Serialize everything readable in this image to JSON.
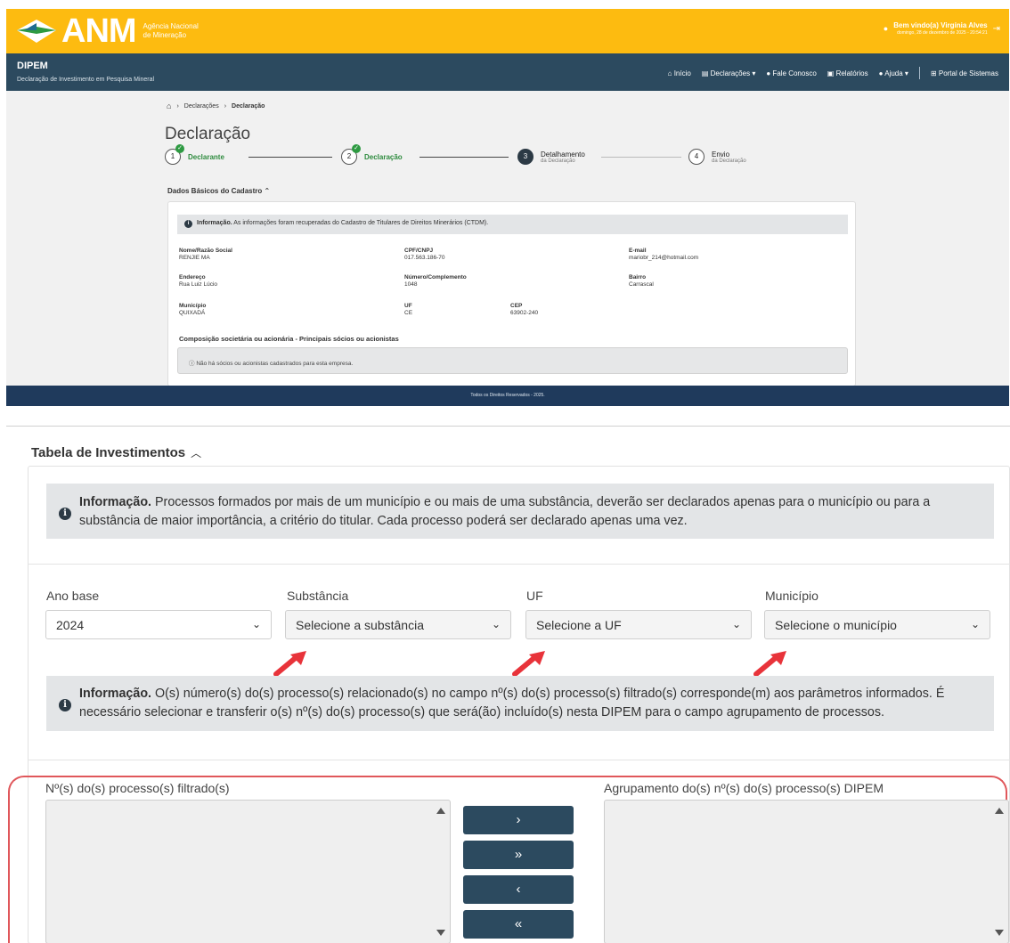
{
  "top": {
    "logo": {
      "text": "ANM",
      "sub": "Agência Nacional de Mineração"
    },
    "user": {
      "greeting": "Bem vindo(a) Virgínia Alves",
      "datetime": "domingo, 28 de dezembro de 2025 - 20:54:21"
    },
    "nav": {
      "brand_title": "DIPEM",
      "brand_subtitle": "Declaração de Investimento em Pesquisa Mineral",
      "links": [
        "Início",
        "Declarações",
        "Fale Conosco",
        "Relatórios",
        "Ajuda",
        "Portal de Sistemas"
      ]
    },
    "breadcrumb": [
      "Declarações",
      "Declaração"
    ],
    "page_title": "Declaração",
    "steps": [
      {
        "num": "1",
        "label": "Declarante",
        "sub": ""
      },
      {
        "num": "2",
        "label": "Declaração",
        "sub": ""
      },
      {
        "num": "3",
        "label": "Detalhamento",
        "sub": "da Declaração"
      },
      {
        "num": "4",
        "label": "Envio",
        "sub": "da Declaração"
      }
    ],
    "section_title": "Dados Básicos do Cadastro",
    "info": {
      "bold": "Informação.",
      "text": " As informações foram recuperadas do Cadastro de Titulares de Direitos Minerários (CTDM)."
    },
    "fields": [
      {
        "key": "Nome/Razão Social",
        "value": "RENJIE MA"
      },
      {
        "key": "CPF/CNPJ",
        "value": "017.563.186-70"
      },
      {
        "key": "E-mail",
        "value": "mariobr_214@hotmail.com"
      },
      {
        "key": "Endereço",
        "value": "Rua Luiz Lúcio"
      },
      {
        "key": "Número/Complemento",
        "value": "1048"
      },
      {
        "key": "Bairro",
        "value": "Carrascal"
      },
      {
        "key": "Município",
        "value": "QUIXADÁ"
      },
      {
        "key": "UF",
        "value": "CE"
      },
      {
        "key": "CEP",
        "value": "63902-240"
      }
    ],
    "composition_title": "Composição societária ou acionária - Principais sócios ou acionistas",
    "no_partners": "Não há sócios ou acionistas cadastrados para esta empresa.",
    "footer": "Todos os Direitos Reservados - 2025."
  },
  "bottom": {
    "section_title": "Tabela de Investimentos",
    "info1": {
      "bold": "Informação.",
      "text": " Processos formados por mais de um município e ou mais de uma substância, deverão ser declarados apenas para o município ou para a substância de maior importância, a critério do titular. Cada processo poderá ser declarado apenas uma vez."
    },
    "filters": [
      {
        "label": "Ano base",
        "value": "2024"
      },
      {
        "label": "Substância",
        "value": "Selecione a substância"
      },
      {
        "label": "UF",
        "value": "Selecione a UF"
      },
      {
        "label": "Município",
        "value": "Selecione o município"
      }
    ],
    "info2": {
      "bold": "Informação.",
      "text": " O(s) número(s) do(s) processo(s) relacionado(s) no campo nº(s) do(s) processo(s) filtrado(s) corresponde(m) aos parâmetros informados. É necessário selecionar e transferir o(s) nº(s) do(s) processo(s) que será(ão) incluído(s) nesta DIPEM para o campo agrupamento de processos."
    },
    "filtered_label": "Nº(s) do(s) processo(s) filtrado(s)",
    "group_label": "Agrupamento do(s) nº(s) do(s) processo(s) DIPEM",
    "buttons": [
      "›",
      "»",
      "‹",
      "«"
    ]
  },
  "colors": {
    "accent_yellow": "#fdbb10",
    "navbar": "#2c4a5f",
    "footer": "#1f3a5c",
    "highlight_red": "#e0575b",
    "arrow_red": "#e8333a",
    "success_green": "#2e9a42"
  }
}
